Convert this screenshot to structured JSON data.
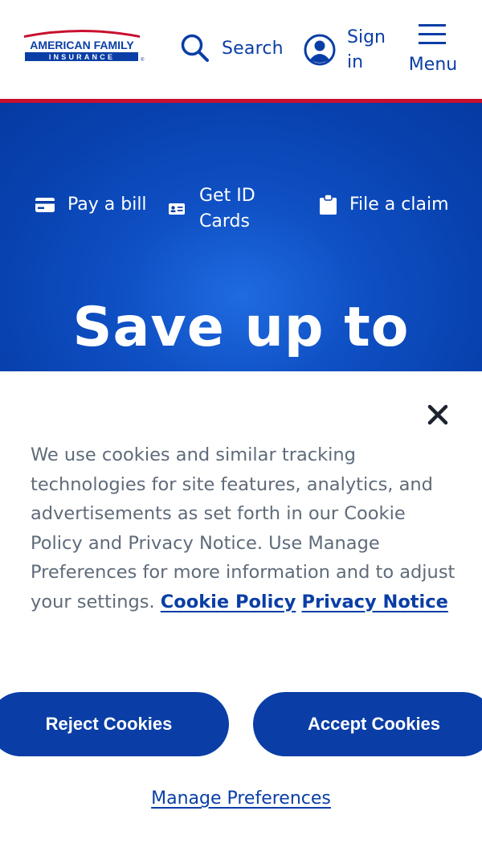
{
  "brand": {
    "logo_line1": "AMERICAN FAMILY",
    "logo_line2": "INSURANCE",
    "logo_mark": "®",
    "colors": {
      "primary_blue": "#0a3ea6",
      "brand_red": "#c8102e",
      "text_gray": "#5f6b7a"
    }
  },
  "header": {
    "search_label": "Search",
    "search_icon": "search-icon",
    "signin_label": "Sign in",
    "signin_icon": "user-circle-icon",
    "menu_label": "Menu",
    "menu_icon": "hamburger-icon"
  },
  "hero": {
    "quick_links": [
      {
        "label": "Pay a bill",
        "icon": "credit-card-icon"
      },
      {
        "label": "Get ID Cards",
        "icon": "id-card-icon"
      },
      {
        "label": "File a claim",
        "icon": "clipboard-icon"
      }
    ],
    "headline": "Save up to"
  },
  "cookie_banner": {
    "close_icon": "close-icon",
    "message": "We use cookies and similar tracking technologies for site features, analytics, and advertisements as set forth in our Cookie Policy and Privacy Notice. Use Manage Preferences for more information and to adjust your settings.",
    "cookie_policy_link": "Cookie Policy",
    "privacy_notice_link": "Privacy Notice",
    "reject_label": "Reject Cookies",
    "accept_label": "Accept Cookies",
    "manage_label": "Manage Preferences"
  }
}
